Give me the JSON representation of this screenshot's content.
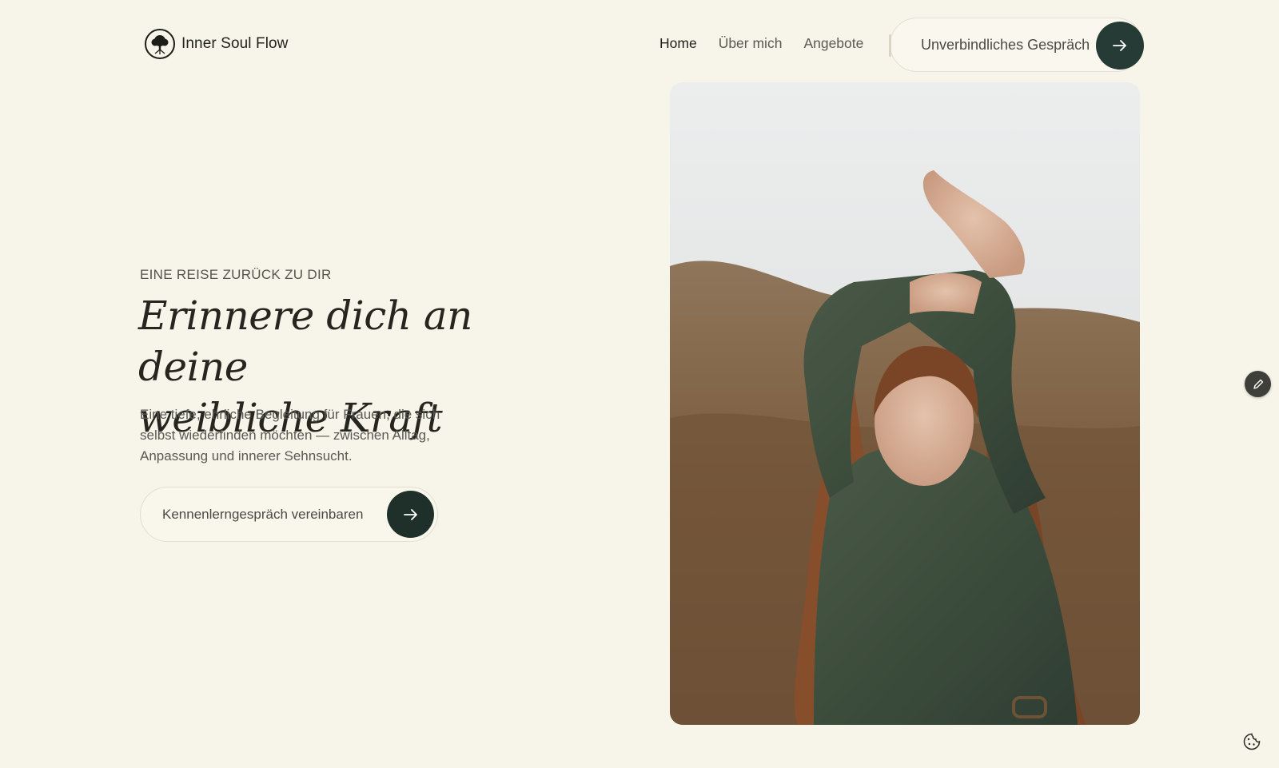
{
  "brand": {
    "name": "Inner Soul Flow",
    "logo_icon": "tree-of-life-icon"
  },
  "nav": {
    "items": [
      {
        "label": "Home",
        "active": true
      },
      {
        "label": "Über mich",
        "active": false
      },
      {
        "label": "Angebote",
        "active": false
      }
    ],
    "cta_label": "Unverbindliches Gespräch",
    "cta_icon": "arrow-right-icon"
  },
  "hero": {
    "eyebrow": "EINE REISE ZURÜCK ZU DIR",
    "headline_line1": "Erinnere dich an deine",
    "headline_line2": "weibliche Kraft",
    "subtext": "Eine tiefe, ehrliche Begleitung für Frauen, die sich selbst wiederfinden möchten — zwischen Alltag, Anpassung und innerer Sehnsucht.",
    "button_label": "Kennenlerngespräch vereinbaren",
    "button_icon": "arrow-right-icon",
    "image_icon": "portrait-photo"
  },
  "widgets": {
    "edit_icon": "pencil-icon",
    "cookie_icon": "cookie-icon"
  },
  "colors": {
    "background": "#f7f5e9",
    "accent_dark_green": "#263b35",
    "text_dark": "#26251f",
    "text_muted": "#5a5954"
  }
}
